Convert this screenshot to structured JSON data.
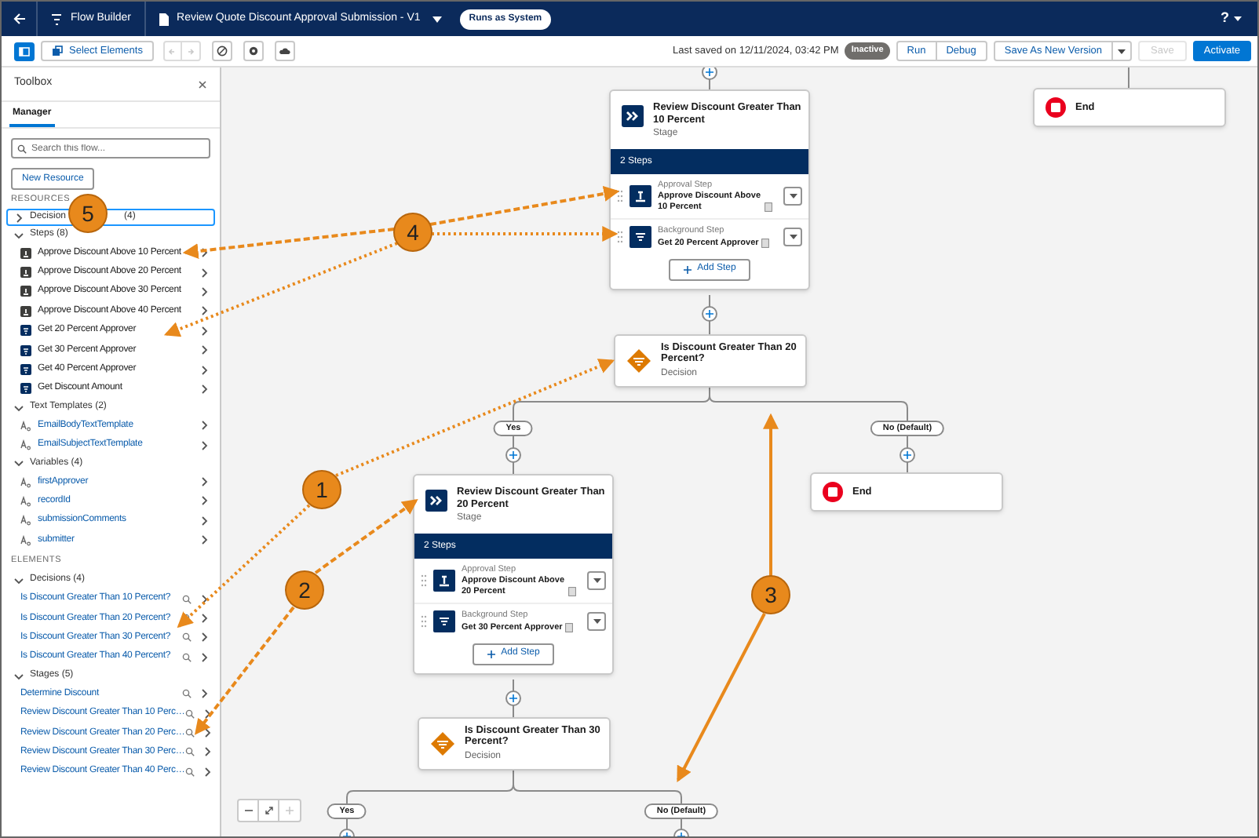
{
  "header": {
    "app_name": "Flow Builder",
    "flow_title": "Review Quote Discount Approval Submission - V1",
    "run_mode": "Runs as System",
    "help": "?"
  },
  "toolbar": {
    "select_elements": "Select Elements",
    "undo_disabled": true,
    "redo_disabled": true,
    "last_saved": "Last saved on 12/11/2024, 03:42 PM",
    "status": "Inactive",
    "run": "Run",
    "debug": "Debug",
    "save_as": "Save As New Version",
    "save": {
      "label": "Save",
      "disabled": true
    },
    "activate": "Activate"
  },
  "toolbox": {
    "title": "Toolbox",
    "tabs": [
      {
        "label": "Manager",
        "selected": true
      }
    ],
    "search_placeholder": "Search this flow...",
    "new_resource": "New Resource",
    "sections": [
      {
        "heading": "RESOURCES",
        "groups": [
          {
            "label": "Decision",
            "tail": "(4)",
            "expanded": false,
            "highlighted": true
          },
          {
            "label": "Steps (8)",
            "expanded": true,
            "highlighted": false,
            "children": [
              {
                "label": "Approve Discount Above 10 Percent",
                "kind": "approval"
              },
              {
                "label": "Approve Discount Above 20 Percent",
                "kind": "approval"
              },
              {
                "label": "Approve Discount Above 30 Percent",
                "kind": "approval"
              },
              {
                "label": "Approve Discount Above 40 Percent",
                "kind": "approval"
              },
              {
                "label": "Get 20 Percent Approver",
                "kind": "background"
              },
              {
                "label": "Get 30 Percent Approver",
                "kind": "background"
              },
              {
                "label": "Get 40 Percent Approver",
                "kind": "background"
              },
              {
                "label": "Get Discount Amount",
                "kind": "background"
              }
            ]
          },
          {
            "label": "Text Templates (2)",
            "expanded": true,
            "highlighted": false,
            "children": [
              {
                "label": "EmailBodyTextTemplate",
                "kind": "text"
              },
              {
                "label": "EmailSubjectTextTemplate",
                "kind": "text"
              }
            ]
          },
          {
            "label": "Variables (4)",
            "expanded": true,
            "highlighted": false,
            "children": [
              {
                "label": "firstApprover",
                "kind": "text"
              },
              {
                "label": "recordId",
                "kind": "text"
              },
              {
                "label": "submissionComments",
                "kind": "text"
              },
              {
                "label": "submitter",
                "kind": "text"
              }
            ]
          }
        ]
      },
      {
        "heading": "ELEMENTS",
        "groups": [
          {
            "label": "Decisions (4)",
            "expanded": true,
            "highlighted": false,
            "children": [
              {
                "label": "Is Discount Greater Than 10 Percent?",
                "kind": "element"
              },
              {
                "label": "Is Discount Greater Than 20 Percent?",
                "kind": "element"
              },
              {
                "label": "Is Discount Greater Than 30 Percent?",
                "kind": "element"
              },
              {
                "label": "Is Discount Greater Than 40 Percent?",
                "kind": "element"
              }
            ]
          },
          {
            "label": "Stages (5)",
            "expanded": true,
            "highlighted": false,
            "children": [
              {
                "label": "Determine Discount",
                "kind": "element"
              },
              {
                "label": "Review Discount Greater Than 10 Perc…",
                "kind": "element"
              },
              {
                "label": "Review Discount Greater Than 20 Perc…",
                "kind": "element"
              },
              {
                "label": "Review Discount Greater Than 30 Perc…",
                "kind": "element"
              },
              {
                "label": "Review Discount Greater Than 40 Perc…",
                "kind": "element"
              }
            ]
          }
        ]
      }
    ]
  },
  "canvas": {
    "stages": [
      {
        "title": "Review Discount Greater Than 10 Percent",
        "type": "Stage",
        "steps_label": "2 Steps",
        "add_step": "Add Step",
        "steps": [
          {
            "kind": "approval",
            "type": "Approval Step",
            "name": "Approve Discount Above 10 Percent"
          },
          {
            "kind": "background",
            "type": "Background Step",
            "name": "Get 20 Percent Approver"
          }
        ]
      },
      {
        "title": "Review Discount Greater Than 20 Percent",
        "type": "Stage",
        "steps_label": "2 Steps",
        "add_step": "Add Step",
        "steps": [
          {
            "kind": "approval",
            "type": "Approval Step",
            "name": "Approve Discount Above 20 Percent"
          },
          {
            "kind": "background",
            "type": "Background Step",
            "name": "Get 30 Percent Approver"
          }
        ]
      }
    ],
    "decisions": [
      {
        "title": "Is Discount Greater Than 20 Percent?",
        "type": "Decision"
      },
      {
        "title": "Is Discount Greater Than 30 Percent?",
        "type": "Decision"
      }
    ],
    "ends": [
      {
        "label": "End"
      },
      {
        "label": "End"
      }
    ],
    "branch_labels": [
      {
        "label": "Yes"
      },
      {
        "label": "No (Default)"
      },
      {
        "label": "Yes"
      },
      {
        "label": "No (Default)"
      }
    ]
  },
  "callouts": [
    {
      "number": "5"
    },
    {
      "number": "4"
    },
    {
      "number": "1"
    },
    {
      "number": "2"
    },
    {
      "number": "3"
    }
  ]
}
